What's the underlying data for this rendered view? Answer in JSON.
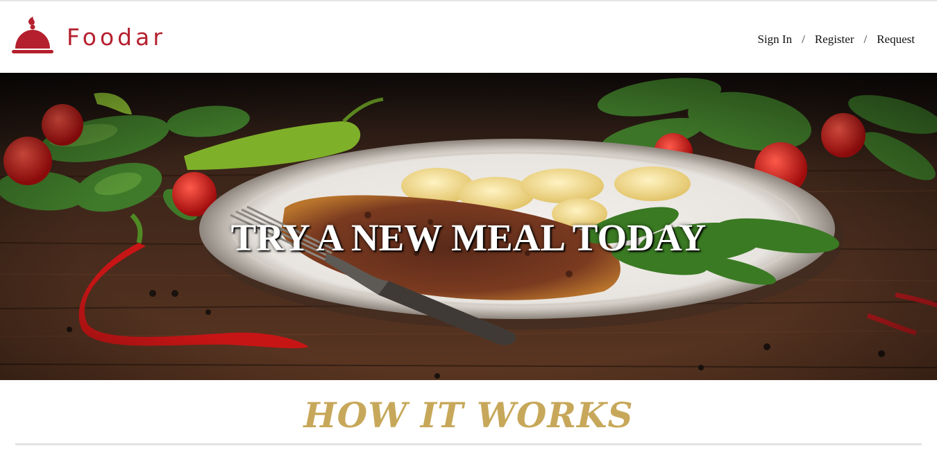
{
  "header": {
    "brand": "Foodar",
    "nav": {
      "sign_in": "Sign In",
      "register": "Register",
      "request": "Request",
      "separator": "/"
    }
  },
  "hero": {
    "title": "TRY A NEW MEAL TODAY"
  },
  "how_it_works": {
    "title": "HOW IT WORKS"
  },
  "colors": {
    "brand": "#b5202e",
    "accent_gold": "#c7a85a"
  }
}
